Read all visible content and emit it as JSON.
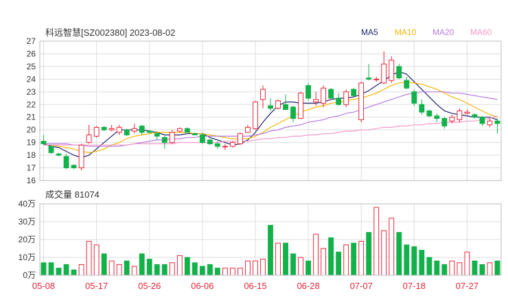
{
  "title": "科远智慧[SZ002380] 2023-08-02",
  "legend": [
    {
      "label": "MA5",
      "color": "#1f1f6e"
    },
    {
      "label": "MA10",
      "color": "#f5b400"
    },
    {
      "label": "MA20",
      "color": "#b57be0"
    },
    {
      "label": "MA60",
      "color": "#f29ac8"
    }
  ],
  "volume_label": "成交量",
  "volume_value": "81074",
  "colors": {
    "up": "#e8253a",
    "down": "#12b14a",
    "grid": "#dddddd"
  },
  "chart_data": [
    {
      "type": "candlestick",
      "ylim": [
        16,
        27
      ],
      "y_ticks": [
        "27",
        "26",
        "25",
        "24",
        "23",
        "22",
        "21",
        "20",
        "19",
        "18",
        "17",
        "16"
      ],
      "x_tick_labels": [
        "05-08",
        "05-17",
        "05-26",
        "06-06",
        "06-15",
        "06-28",
        "07-07",
        "07-18",
        "07-27"
      ],
      "dates": [
        "05-08",
        "05-09",
        "05-10",
        "05-11",
        "05-12",
        "05-15",
        "05-16",
        "05-17",
        "05-18",
        "05-19",
        "05-22",
        "05-23",
        "05-24",
        "05-25",
        "05-26",
        "05-29",
        "05-30",
        "05-31",
        "06-01",
        "06-02",
        "06-05",
        "06-06",
        "06-07",
        "06-08",
        "06-09",
        "06-12",
        "06-13",
        "06-14",
        "06-15",
        "06-16",
        "06-19",
        "06-20",
        "06-21",
        "06-26",
        "06-27",
        "06-28",
        "06-29",
        "06-30",
        "07-03",
        "07-04",
        "07-05",
        "07-06",
        "07-07",
        "07-10",
        "07-11",
        "07-12",
        "07-13",
        "07-14",
        "07-17",
        "07-18",
        "07-19",
        "07-20",
        "07-21",
        "07-24",
        "07-25",
        "07-26",
        "07-27",
        "07-28",
        "07-31",
        "08-01",
        "08-02"
      ],
      "ohlc": [
        [
          19.1,
          19.6,
          18.8,
          18.9
        ],
        [
          18.7,
          18.8,
          18.1,
          18.2
        ],
        [
          18.1,
          18.2,
          17.9,
          18.0
        ],
        [
          17.9,
          18.1,
          16.9,
          17.0
        ],
        [
          17.2,
          17.3,
          16.9,
          17.0
        ],
        [
          17.0,
          18.9,
          16.8,
          18.8
        ],
        [
          19.0,
          20.4,
          18.9,
          19.6
        ],
        [
          19.5,
          20.3,
          19.4,
          20.2
        ],
        [
          20.2,
          20.3,
          19.9,
          20.0
        ],
        [
          20.0,
          20.4,
          19.9,
          20.1
        ],
        [
          19.8,
          20.4,
          19.6,
          20.2
        ],
        [
          20.0,
          20.1,
          19.5,
          19.6
        ],
        [
          19.9,
          20.5,
          19.7,
          20.1
        ],
        [
          20.3,
          20.4,
          19.6,
          19.8
        ],
        [
          19.9,
          20.0,
          19.7,
          19.8
        ],
        [
          19.7,
          19.9,
          19.2,
          19.5
        ],
        [
          19.4,
          19.5,
          18.5,
          19.0
        ],
        [
          19.0,
          20.0,
          18.9,
          19.8
        ],
        [
          19.9,
          20.2,
          19.8,
          20.1
        ],
        [
          20.1,
          20.2,
          19.8,
          19.8
        ],
        [
          19.7,
          19.8,
          19.6,
          19.6
        ],
        [
          19.6,
          19.8,
          18.9,
          19.0
        ],
        [
          19.2,
          19.3,
          18.8,
          18.9
        ],
        [
          18.9,
          19.1,
          18.5,
          18.7
        ],
        [
          18.7,
          18.9,
          18.4,
          18.7
        ],
        [
          18.7,
          19.1,
          18.6,
          19.0
        ],
        [
          18.9,
          19.8,
          18.8,
          19.7
        ],
        [
          19.8,
          20.4,
          19.8,
          20.2
        ],
        [
          20.1,
          22.3,
          20.0,
          22.2
        ],
        [
          22.4,
          23.5,
          21.7,
          23.2
        ],
        [
          21.9,
          22.5,
          21.5,
          21.7
        ],
        [
          21.7,
          22.4,
          21.6,
          22.3
        ],
        [
          22.0,
          22.8,
          21.6,
          21.6
        ],
        [
          21.8,
          21.9,
          20.6,
          20.9
        ],
        [
          20.9,
          23.0,
          20.9,
          22.9
        ],
        [
          23.5,
          23.7,
          22.3,
          22.5
        ],
        [
          22.2,
          23.0,
          21.9,
          22.4
        ],
        [
          22.1,
          23.5,
          21.8,
          23.3
        ],
        [
          23.2,
          23.3,
          22.5,
          22.5
        ],
        [
          22.5,
          22.9,
          21.9,
          22.0
        ],
        [
          22.0,
          23.2,
          21.8,
          23.0
        ],
        [
          23.2,
          23.3,
          22.6,
          22.7
        ],
        [
          20.8,
          23.8,
          20.6,
          23.7
        ],
        [
          24.1,
          25.2,
          23.9,
          24.0
        ],
        [
          24.0,
          24.2,
          23.8,
          24.0
        ],
        [
          23.7,
          26.2,
          23.6,
          25.2
        ],
        [
          23.9,
          25.8,
          23.7,
          25.5
        ],
        [
          25.0,
          25.2,
          24.0,
          24.1
        ],
        [
          23.9,
          24.2,
          23.2,
          23.3
        ],
        [
          23.0,
          23.2,
          21.9,
          22.1
        ],
        [
          22.0,
          22.4,
          21.2,
          21.4
        ],
        [
          21.5,
          21.6,
          21.0,
          21.1
        ],
        [
          21.1,
          21.3,
          20.6,
          20.9
        ],
        [
          20.9,
          21.0,
          20.1,
          20.3
        ],
        [
          20.7,
          21.2,
          20.5,
          21.0
        ],
        [
          20.8,
          21.7,
          20.6,
          21.5
        ],
        [
          21.3,
          21.6,
          21.2,
          21.4
        ],
        [
          21.2,
          21.3,
          20.9,
          21.0
        ],
        [
          21.0,
          21.1,
          20.3,
          20.5
        ],
        [
          20.4,
          20.9,
          20.2,
          20.7
        ],
        [
          20.7,
          20.9,
          19.7,
          20.5
        ]
      ],
      "ma5": [
        18.9,
        18.7,
        18.6,
        18.3,
        18.0,
        17.8,
        18.0,
        18.5,
        19.0,
        19.5,
        20.0,
        20.0,
        20.0,
        20.0,
        19.9,
        19.8,
        19.6,
        19.6,
        19.6,
        19.7,
        19.7,
        19.7,
        19.4,
        19.2,
        19.0,
        18.8,
        18.9,
        19.2,
        19.8,
        20.6,
        21.3,
        21.9,
        22.2,
        22.2,
        22.1,
        22.1,
        22.1,
        22.2,
        22.4,
        22.5,
        22.5,
        22.6,
        22.8,
        23.1,
        23.5,
        23.9,
        24.3,
        24.6,
        24.4,
        23.8,
        23.2,
        22.6,
        22.0,
        21.5,
        21.3,
        21.2,
        21.1,
        21.0,
        21.0,
        21.0,
        20.8
      ],
      "ma10": [
        18.8,
        18.8,
        18.7,
        18.6,
        18.5,
        18.3,
        18.2,
        18.3,
        18.5,
        18.8,
        19.0,
        19.3,
        19.5,
        19.6,
        19.7,
        19.8,
        19.8,
        19.8,
        19.8,
        19.8,
        19.7,
        19.7,
        19.6,
        19.5,
        19.4,
        19.3,
        19.3,
        19.3,
        19.5,
        19.8,
        20.2,
        20.5,
        20.8,
        21.1,
        21.4,
        21.6,
        21.8,
        21.9,
        22.1,
        22.2,
        22.3,
        22.4,
        22.5,
        22.7,
        22.9,
        23.2,
        23.5,
        23.7,
        23.8,
        23.7,
        23.6,
        23.4,
        23.2,
        22.9,
        22.6,
        22.4,
        22.1,
        21.8,
        21.5,
        21.2,
        21.0
      ],
      "ma20": [
        18.9,
        18.9,
        18.9,
        18.9,
        18.8,
        18.8,
        18.7,
        18.7,
        18.7,
        18.7,
        18.7,
        18.8,
        18.9,
        19.0,
        19.1,
        19.2,
        19.2,
        19.3,
        19.3,
        19.4,
        19.4,
        19.5,
        19.5,
        19.5,
        19.5,
        19.5,
        19.5,
        19.5,
        19.6,
        19.7,
        19.9,
        20.0,
        20.2,
        20.3,
        20.4,
        20.6,
        20.7,
        20.8,
        21.0,
        21.1,
        21.3,
        21.4,
        21.6,
        21.8,
        22.0,
        22.2,
        22.4,
        22.6,
        22.8,
        22.9,
        23.0,
        23.0,
        23.0,
        23.0,
        22.9,
        22.9,
        22.8,
        22.7,
        22.6,
        22.5,
        22.4
      ],
      "ma60": [
        18.8,
        18.8,
        18.8,
        18.8,
        18.8,
        18.8,
        18.8,
        18.8,
        18.8,
        18.8,
        18.8,
        18.8,
        18.9,
        18.9,
        18.9,
        18.9,
        18.9,
        18.9,
        19.0,
        19.0,
        19.0,
        19.0,
        19.0,
        19.0,
        19.1,
        19.1,
        19.1,
        19.1,
        19.2,
        19.3,
        19.3,
        19.4,
        19.4,
        19.5,
        19.5,
        19.6,
        19.6,
        19.7,
        19.7,
        19.8,
        19.9,
        19.9,
        20.0,
        20.0,
        20.1,
        20.2,
        20.2,
        20.3,
        20.3,
        20.4,
        20.4,
        20.5,
        20.5,
        20.6,
        20.6,
        20.6,
        20.7,
        20.7,
        20.8,
        20.9,
        21.1
      ]
    },
    {
      "type": "bar",
      "ylim": [
        0,
        40
      ],
      "y_ticks": [
        "40万",
        "30万",
        "20万",
        "10万",
        "0万"
      ],
      "values": [
        7,
        7,
        4,
        6,
        3,
        6,
        19,
        17,
        12,
        8,
        6,
        8,
        5,
        12,
        9,
        6,
        6,
        7,
        11,
        10,
        7,
        5,
        6,
        4,
        4,
        4,
        4,
        8,
        8,
        9,
        28,
        18,
        18,
        12,
        10,
        8,
        23,
        15,
        21,
        13,
        17,
        18,
        19,
        24,
        38,
        25,
        32,
        24,
        17,
        16,
        14,
        10,
        8,
        6,
        8,
        7,
        13,
        8,
        6,
        7,
        8
      ]
    }
  ]
}
